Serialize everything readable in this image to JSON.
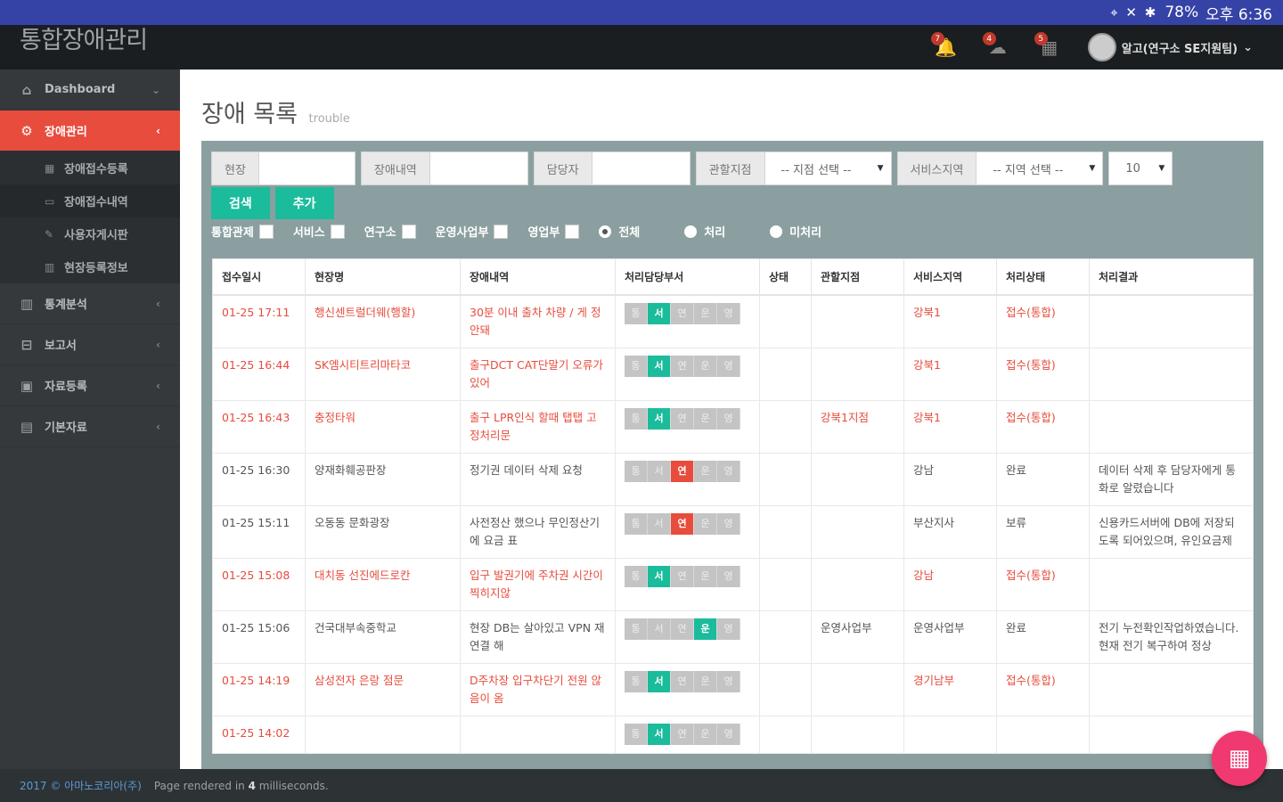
{
  "statusbar": {
    "icons": "⌖ ✕ ✱",
    "battery": "78%",
    "time": "오후 6:36"
  },
  "header": {
    "brand": "통합장애관리",
    "notifications": [
      {
        "icon": "bell-icon",
        "glyph": "🔔",
        "count": "7"
      },
      {
        "icon": "cloud-icon",
        "glyph": "☁",
        "count": "4"
      },
      {
        "icon": "calendar-icon",
        "glyph": "▦",
        "count": "5"
      }
    ],
    "user_name": "알고(연구소 SE지원팀)"
  },
  "sidebar": {
    "items": [
      {
        "label": "Dashboard",
        "icon": "⌂"
      },
      {
        "label": "장애관리",
        "icon": "⚙"
      },
      {
        "label": "통계분석",
        "icon": "▥"
      },
      {
        "label": "보고서",
        "icon": "⊟"
      },
      {
        "label": "자료등록",
        "icon": "▣"
      },
      {
        "label": "기본자료",
        "icon": "▤"
      }
    ],
    "sub_items": [
      {
        "label": "장애접수등록",
        "icon": "▦"
      },
      {
        "label": "장애접수내역",
        "icon": "▭"
      },
      {
        "label": "사용자게시판",
        "icon": "✎"
      },
      {
        "label": "현장등록정보",
        "icon": "▥"
      }
    ]
  },
  "page": {
    "title": "장애 목록",
    "subtitle": "trouble"
  },
  "filters": {
    "site_label": "현장",
    "site_value": "",
    "detail_label": "장애내역",
    "detail_value": "",
    "manager_label": "담당자",
    "manager_value": "",
    "branch_label": "관할지점",
    "branch_value": "-- 지점 선택 --",
    "region_label": "서비스지역",
    "region_value": "-- 지역 선택 --",
    "page_size": "10",
    "search_label": "검색",
    "add_label": "추가",
    "checkboxes": [
      "통합관제",
      "서비스",
      "연구소",
      "운영사업부",
      "영업부"
    ],
    "radios": [
      "전체",
      "처리",
      "미처리"
    ]
  },
  "table": {
    "headers": [
      "접수일시",
      "현장명",
      "장애내역",
      "처리담당부서",
      "상태",
      "관할지점",
      "서비스지역",
      "처리상태",
      "처리결과"
    ],
    "stage_labels": [
      "통",
      "서",
      "연",
      "운",
      "영"
    ],
    "rows": [
      {
        "date": "01-25 17:11",
        "site": "행신센트럴더웨(행할)",
        "detail": "30분 이내 출차 차량 / 게 정안돼",
        "status": "",
        "branch": "",
        "region": "강북1",
        "proc": "접수(통합)",
        "result": "",
        "red": true,
        "active": 1,
        "active_color": "teal"
      },
      {
        "date": "01-25 16:44",
        "site": "SK엠시티트리마타코",
        "detail": "출구DCT CAT단말기 오류가 있어",
        "status": "",
        "branch": "",
        "region": "강북1",
        "proc": "접수(통합)",
        "result": "",
        "red": true,
        "active": 1,
        "active_color": "teal"
      },
      {
        "date": "01-25 16:43",
        "site": "충정타워",
        "detail": "출구 LPR인식 할때 탭탭 고정처리문",
        "status": "",
        "branch": "강북1지점",
        "region": "강북1",
        "proc": "접수(통합)",
        "result": "",
        "red": true,
        "active": 1,
        "active_color": "teal"
      },
      {
        "date": "01-25 16:30",
        "site": "양재화훼공판장",
        "detail": "정기권 데이터 삭제 요청",
        "status": "",
        "branch": "",
        "region": "강남",
        "proc": "완료",
        "result": "데이터 삭제 후 담당자에게 통화로 알렸습니다",
        "red": false,
        "active": 2,
        "active_color": "red"
      },
      {
        "date": "01-25 15:11",
        "site": "오동동 문화광장",
        "detail": "사전정산 했으나 무인정산기에 요금 표",
        "status": "",
        "branch": "",
        "region": "부산지사",
        "proc": "보류",
        "result": "신용카드서버에 DB에 저장되도록 되어있으며, 유인요금제",
        "red": false,
        "active": 2,
        "active_color": "red"
      },
      {
        "date": "01-25 15:08",
        "site": "대치동 선진에드로칸",
        "detail": "입구 발권기에 주차권 시간이 찍히지않",
        "status": "",
        "branch": "",
        "region": "강남",
        "proc": "접수(통합)",
        "result": "",
        "red": true,
        "active": 1,
        "active_color": "teal"
      },
      {
        "date": "01-25 15:06",
        "site": "건국대부속중학교",
        "detail": "현장 DB는 살아있고 VPN 재연결 해",
        "status": "",
        "branch": "운영사업부",
        "region": "운영사업부",
        "proc": "완료",
        "result": "전기 누전확인작업하였습니다. 현재 전기 복구하여 정상",
        "red": false,
        "active": 3,
        "active_color": "teal"
      },
      {
        "date": "01-25 14:19",
        "site": "삼성전자 은랑 점문",
        "detail": "D주차장 입구차단기 전원 않음이 옴",
        "status": "",
        "branch": "",
        "region": "경기남부",
        "proc": "접수(통합)",
        "result": "",
        "red": true,
        "active": 1,
        "active_color": "teal"
      },
      {
        "date": "01-25 14:02",
        "site": "",
        "detail": "",
        "status": "",
        "branch": "",
        "region": "",
        "proc": "",
        "result": "",
        "red": true,
        "active": 1,
        "active_color": "teal"
      }
    ]
  },
  "footer": {
    "copyright": "2017 © 아마노코리아(주)",
    "rendered_prefix": "Page rendered in",
    "rendered_ms": "4",
    "rendered_suffix": "milliseconds."
  },
  "fab_icon": "grid-icon"
}
